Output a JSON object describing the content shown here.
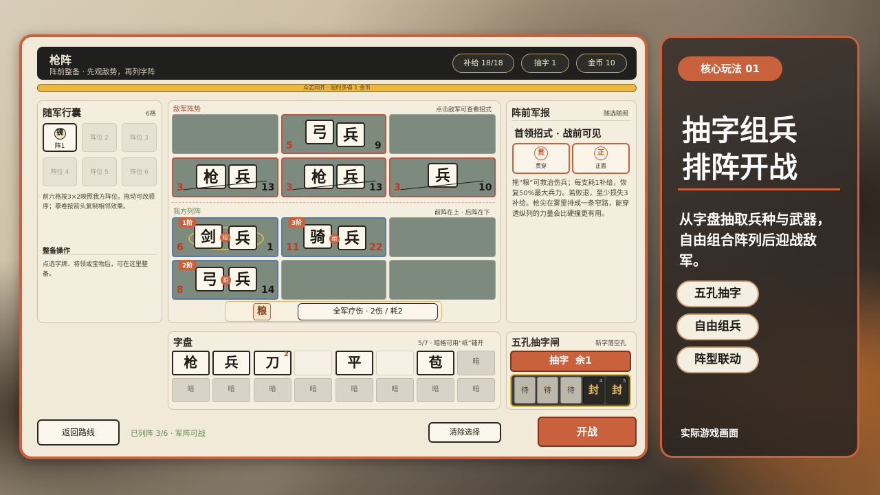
{
  "stage": {
    "title": "枪阵",
    "subtitle": "阵前整备 · 先观敌势，再列字阵"
  },
  "stats": {
    "supply": "补给 18/18",
    "draw": "抽字 1",
    "gold": "金币 10"
  },
  "banner": "众志同齐 · 图时多得 1 金币",
  "bag": {
    "title": "随军行囊",
    "count": "6格",
    "slots": [
      {
        "icon": "镜",
        "label": "阵1"
      },
      {
        "label": "阵位 2"
      },
      {
        "label": "阵位 3"
      },
      {
        "label": "阵位 4"
      },
      {
        "label": "阵位 5"
      },
      {
        "label": "阵位 6"
      }
    ],
    "desc": "前六格按3×2映照我方阵位。拖动可改顺序；摹卷按箭头复制相邻效果。",
    "ops_title": "整备操作",
    "ops_desc": "点选字牌、将领或宝物后，可在这里整备。"
  },
  "battlefield": {
    "enemy_title": "敌军阵势",
    "enemy_hint": "点击敌军可查看招式",
    "ally_title": "我方列阵",
    "ally_hint": "前阵在上 · 后阵在下",
    "enemy_units": [
      {
        "tiles": [
          "弓",
          "兵"
        ],
        "left": "5",
        "right": "9"
      },
      {
        "tiles": [
          "枪",
          "兵"
        ],
        "left": "3",
        "right": "13"
      },
      {
        "tiles": [
          "枪",
          "兵"
        ],
        "left": "3",
        "right": "13"
      },
      {
        "tiles": [
          "兵"
        ],
        "left": "3",
        "right": "10"
      }
    ],
    "ally_units": [
      {
        "rank": "1阶",
        "tiles": [
          "剑",
          "兵"
        ],
        "chip": "组",
        "left": "6",
        "right": "1"
      },
      {
        "rank": "3阶",
        "tiles": [
          "骑",
          "兵"
        ],
        "chip": "组",
        "left": "11",
        "right": "22"
      },
      {
        "rank": "2阶",
        "tiles": [
          "弓",
          "兵"
        ],
        "chip": "组",
        "left": "8",
        "right": "14"
      }
    ],
    "supply_icon": "粮",
    "supply_text": "全军疗伤 · 2伤 / 耗2"
  },
  "report": {
    "title": "阵前军报",
    "hint": "随选随阅",
    "heading": "首领招式 · 战前可见",
    "skills": [
      {
        "icon": "贯",
        "label": "贯穿"
      },
      {
        "icon": "正",
        "label": "正面"
      }
    ],
    "text": "拖“粮”可救治伤兵；每支耗1补给，恢复50%最大兵力。若败退，至少损失3补给。枪尖在雾里排成一条窄路，能穿透纵列的力量会比硬撞更有用。"
  },
  "board": {
    "title": "字盘",
    "hint": "5/7 · 暗格可用“纸”铺开",
    "top": [
      "枪",
      "兵",
      "刀",
      "",
      "平",
      "",
      "苞",
      "暗"
    ],
    "superscript": "2",
    "bottom": [
      "暗",
      "暗",
      "暗",
      "暗",
      "暗",
      "暗",
      "暗",
      "暗"
    ]
  },
  "gate": {
    "title": "五孔抽字闸",
    "hint": "新字落空孔",
    "draw_label": "抽字  余1",
    "holes": [
      {
        "t": "待"
      },
      {
        "t": "待"
      },
      {
        "t": "待"
      },
      {
        "t": "封",
        "n": "4"
      },
      {
        "t": "封",
        "n": "5"
      }
    ]
  },
  "footer": {
    "back": "返回路线",
    "status": "已列阵 3/6 · 军阵可战",
    "clear": "清除选择",
    "fight": "开战"
  },
  "side": {
    "tag": "核心玩法 01",
    "heading1": "抽字组兵",
    "heading2": "排阵开战",
    "desc": "从字盘抽取兵种与武器，自由组合阵列后迎战敌军。",
    "features": [
      "五孔抽字",
      "自由组兵",
      "阵型联动"
    ],
    "caption": "实际游戏画面"
  },
  "colors": {
    "accent": "#c8613c",
    "frame_bg": "#f1ead9",
    "topbar": "#1f201d",
    "gold": "#e8b840"
  }
}
